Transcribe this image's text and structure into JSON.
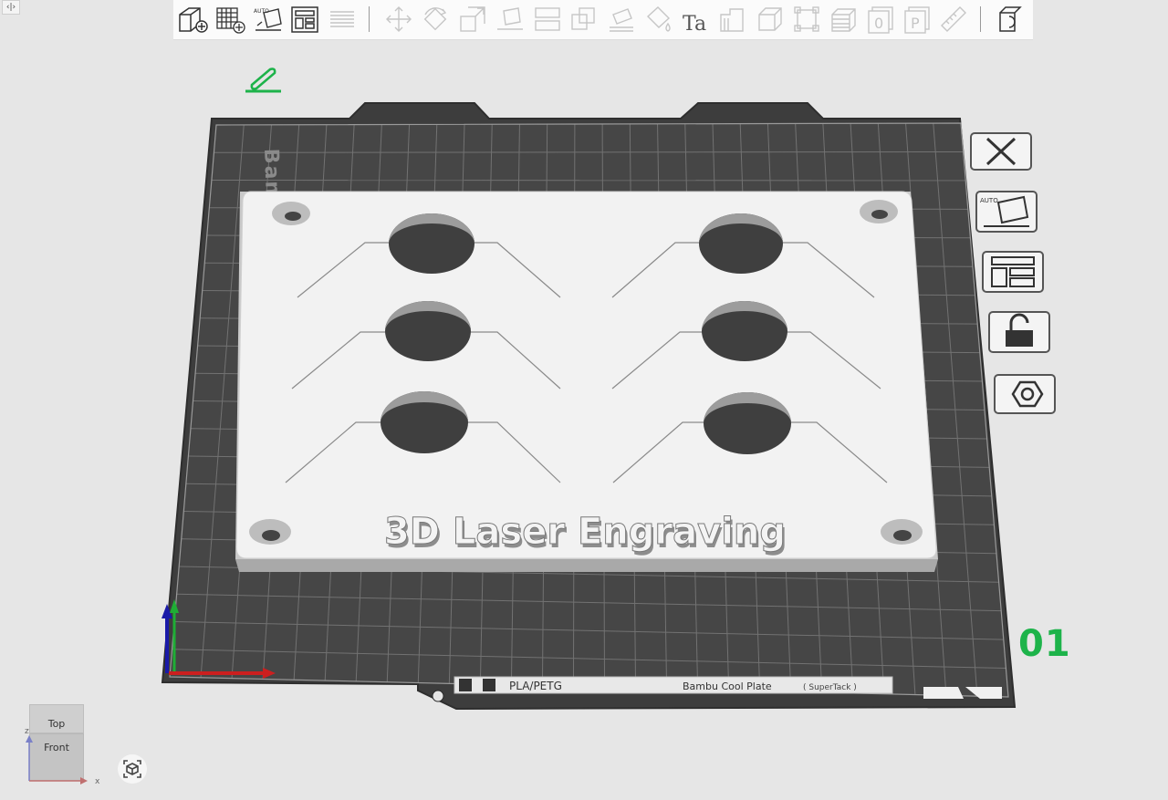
{
  "corner_toggle": {
    "label": "‹|›"
  },
  "toolbar": {
    "auto_badge": "AUTO",
    "text_tool_glyph": "Ta",
    "part0_glyph": "0",
    "partP_glyph": "P",
    "items": [
      {
        "icon": "add-cube-icon"
      },
      {
        "icon": "add-plate-icon"
      },
      {
        "icon": "auto-orient-icon"
      },
      {
        "icon": "arrange-icon"
      },
      {
        "icon": "layers-icon"
      },
      {
        "icon": "move-icon"
      },
      {
        "icon": "rotate-icon"
      },
      {
        "icon": "scale-icon"
      },
      {
        "icon": "lay-on-face-icon"
      },
      {
        "icon": "cut-icon"
      },
      {
        "icon": "boolean-icon"
      },
      {
        "icon": "support-paint-icon"
      },
      {
        "icon": "color-paint-icon"
      },
      {
        "icon": "text-tool-icon"
      },
      {
        "icon": "fuzzy-skin-icon"
      },
      {
        "icon": "cube-view-icon"
      },
      {
        "icon": "bounding-box-icon"
      },
      {
        "icon": "stack-icon"
      },
      {
        "icon": "part-0-icon"
      },
      {
        "icon": "part-p-icon"
      },
      {
        "icon": "measure-icon"
      },
      {
        "icon": "assembly-icon"
      }
    ]
  },
  "plate": {
    "side_label": "Bambu Cool Plate",
    "footer_filament": "PLA/PETG",
    "footer_plate": "Bambu Cool Plate",
    "footer_plate_variant": "( SuperTack )",
    "number": "01"
  },
  "model": {
    "text": "3D Laser Engraving"
  },
  "view_cube": {
    "top": "Top",
    "front": "Front",
    "axis_z": "z",
    "axis_x": "x"
  },
  "colors": {
    "background": "#e6e6e6",
    "plate": "#3d3d3d",
    "grid": "#6a6a6a",
    "model": "#f2f2f2",
    "accent_green": "#1db34a",
    "axis_x": "#cc1f1f",
    "axis_y": "#1fae35",
    "axis_z": "#1a1aa8"
  }
}
